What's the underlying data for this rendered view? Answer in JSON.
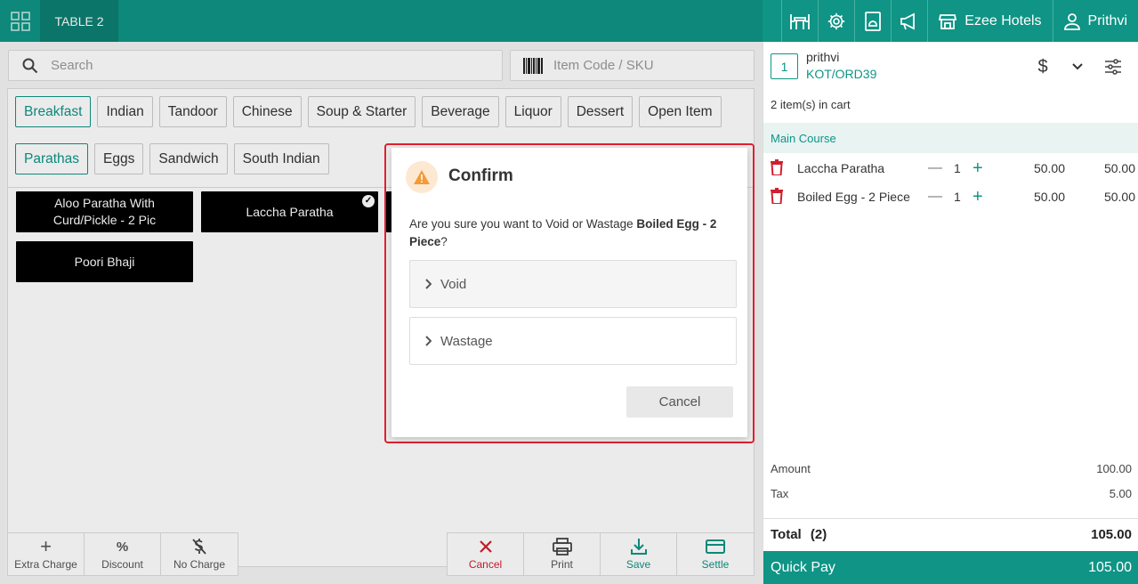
{
  "topbar": {
    "table_label": "TABLE 2",
    "hotel_name": "Ezee Hotels",
    "user_name": "Prithvi",
    "icons": [
      "grid-icon",
      "table-icon",
      "gear-icon",
      "room-service-icon",
      "megaphone-icon",
      "store-icon",
      "user-icon"
    ]
  },
  "search": {
    "placeholder": "Search",
    "sku_placeholder": "Item Code / SKU"
  },
  "categories": [
    "Breakfast",
    "Indian",
    "Tandoor",
    "Chinese",
    "Soup & Starter",
    "Beverage",
    "Liquor",
    "Dessert",
    "Open Item"
  ],
  "active_category": "Breakfast",
  "subcategories": [
    "Parathas",
    "Eggs",
    "Sandwich",
    "South Indian"
  ],
  "active_subcategory": "Parathas",
  "items": [
    {
      "name": "Aloo Paratha With Curd/Pickle - 2 Pic",
      "selected": false
    },
    {
      "name": "Laccha Paratha",
      "selected": true
    },
    {
      "name": "Poori Bhaji",
      "selected": false
    }
  ],
  "bottom_left": [
    "Extra Charge",
    "Discount",
    "No Charge"
  ],
  "bottom_right": [
    "Cancel",
    "Print",
    "Save",
    "Settle"
  ],
  "order": {
    "guest_count": "1",
    "guest_name": "prithvi",
    "order_no": "KOT/ORD39",
    "cart_count": "2 item(s) in cart",
    "group": "Main Course",
    "lines": [
      {
        "name": "Laccha Paratha",
        "qty": "1",
        "price": "50.00",
        "total": "50.00"
      },
      {
        "name": "Boiled Egg - 2 Piece",
        "qty": "1",
        "price": "50.00",
        "total": "50.00"
      }
    ],
    "amount_label": "Amount",
    "amount": "100.00",
    "tax_label": "Tax",
    "tax": "5.00",
    "total_label": "Total",
    "total_count": "(2)",
    "total": "105.00",
    "quickpay_label": "Quick Pay",
    "quickpay_amount": "105.00",
    "minus_symbol": "—",
    "plus_symbol": "+"
  },
  "modal": {
    "title": "Confirm",
    "message_prefix": "Are you sure you want to Void or Wastage ",
    "message_item": "Boiled Egg - 2 Piece",
    "message_suffix": "?",
    "options": [
      "Void",
      "Wastage"
    ],
    "cancel_label": "Cancel"
  },
  "colors": {
    "primary": "#0f9485",
    "danger": "#d01f2e",
    "warning": "#f39a3a"
  }
}
